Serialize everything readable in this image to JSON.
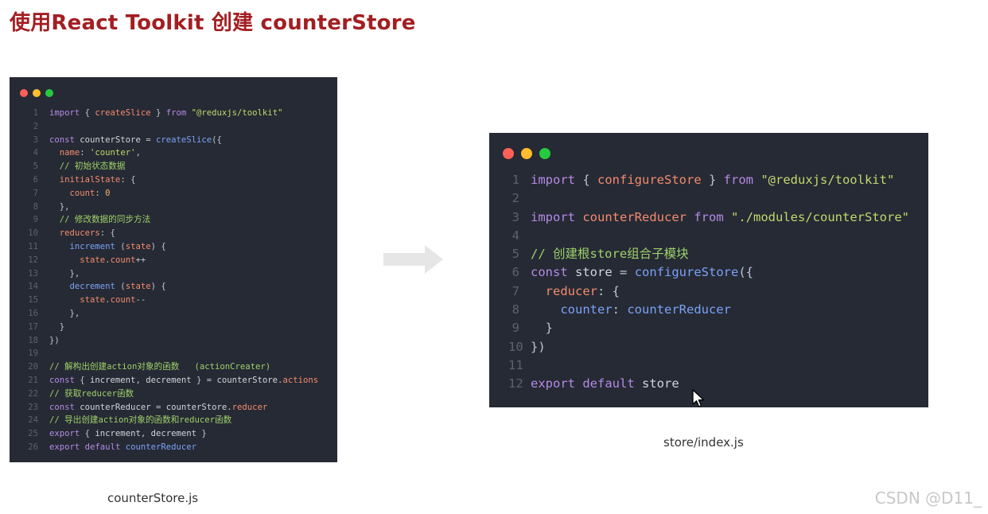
{
  "title": "使用React Toolkit 创建 counterStore",
  "colors": {
    "title": "#a31e22",
    "window_bg": "#262a34",
    "dot_red": "#ff5f56",
    "dot_yellow": "#ffbd2e",
    "dot_green": "#27c93f",
    "line_number": "#5b6270"
  },
  "syntax_colors": {
    "kw": "#b58ae6",
    "fn": "#7aa2f7",
    "str": "#c4d66e",
    "prop": "#f38b6e",
    "cmt": "#9ed16b",
    "punc": "#c0c5ce",
    "num": "#f7b267",
    "def": "#d0d5dd"
  },
  "left_window": {
    "caption": "counterStore.js",
    "lines": [
      {
        "n": "1",
        "tokens": [
          {
            "t": "import",
            "c": "kw"
          },
          {
            "t": " { ",
            "c": "punc"
          },
          {
            "t": "createSlice",
            "c": "prop"
          },
          {
            "t": " } ",
            "c": "punc"
          },
          {
            "t": "from",
            "c": "kw"
          },
          {
            "t": " ",
            "c": "punc"
          },
          {
            "t": "\"@reduxjs/toolkit\"",
            "c": "str"
          }
        ]
      },
      {
        "n": "2",
        "tokens": []
      },
      {
        "n": "3",
        "tokens": [
          {
            "t": "const",
            "c": "kw"
          },
          {
            "t": " ",
            "c": "punc"
          },
          {
            "t": "counterStore",
            "c": "def"
          },
          {
            "t": " = ",
            "c": "punc"
          },
          {
            "t": "createSlice",
            "c": "fn"
          },
          {
            "t": "({",
            "c": "punc"
          }
        ]
      },
      {
        "n": "4",
        "tokens": [
          {
            "t": "  ",
            "c": "punc"
          },
          {
            "t": "name",
            "c": "prop"
          },
          {
            "t": ": ",
            "c": "punc"
          },
          {
            "t": "'counter'",
            "c": "str"
          },
          {
            "t": ",",
            "c": "punc"
          }
        ]
      },
      {
        "n": "5",
        "tokens": [
          {
            "t": "  // 初始状态数据",
            "c": "cmt"
          }
        ]
      },
      {
        "n": "6",
        "tokens": [
          {
            "t": "  ",
            "c": "punc"
          },
          {
            "t": "initialState",
            "c": "prop"
          },
          {
            "t": ": {",
            "c": "punc"
          }
        ]
      },
      {
        "n": "7",
        "tokens": [
          {
            "t": "    ",
            "c": "punc"
          },
          {
            "t": "count",
            "c": "prop"
          },
          {
            "t": ": ",
            "c": "punc"
          },
          {
            "t": "0",
            "c": "num"
          }
        ]
      },
      {
        "n": "8",
        "tokens": [
          {
            "t": "  },",
            "c": "punc"
          }
        ]
      },
      {
        "n": "9",
        "tokens": [
          {
            "t": "  // 修改数据的同步方法",
            "c": "cmt"
          }
        ]
      },
      {
        "n": "10",
        "tokens": [
          {
            "t": "  ",
            "c": "punc"
          },
          {
            "t": "reducers",
            "c": "prop"
          },
          {
            "t": ": {",
            "c": "punc"
          }
        ]
      },
      {
        "n": "11",
        "tokens": [
          {
            "t": "    ",
            "c": "punc"
          },
          {
            "t": "increment",
            "c": "fn"
          },
          {
            "t": " (",
            "c": "punc"
          },
          {
            "t": "state",
            "c": "prop"
          },
          {
            "t": ") {",
            "c": "punc"
          }
        ]
      },
      {
        "n": "12",
        "tokens": [
          {
            "t": "      ",
            "c": "punc"
          },
          {
            "t": "state",
            "c": "prop"
          },
          {
            "t": ".",
            "c": "punc"
          },
          {
            "t": "count",
            "c": "prop"
          },
          {
            "t": "++",
            "c": "punc"
          }
        ]
      },
      {
        "n": "13",
        "tokens": [
          {
            "t": "    },",
            "c": "punc"
          }
        ]
      },
      {
        "n": "14",
        "tokens": [
          {
            "t": "    ",
            "c": "punc"
          },
          {
            "t": "decrement",
            "c": "fn"
          },
          {
            "t": " (",
            "c": "punc"
          },
          {
            "t": "state",
            "c": "prop"
          },
          {
            "t": ") {",
            "c": "punc"
          }
        ]
      },
      {
        "n": "15",
        "tokens": [
          {
            "t": "      ",
            "c": "punc"
          },
          {
            "t": "state",
            "c": "prop"
          },
          {
            "t": ".",
            "c": "punc"
          },
          {
            "t": "count",
            "c": "prop"
          },
          {
            "t": "--",
            "c": "punc"
          }
        ]
      },
      {
        "n": "16",
        "tokens": [
          {
            "t": "    },",
            "c": "punc"
          }
        ]
      },
      {
        "n": "17",
        "tokens": [
          {
            "t": "  }",
            "c": "punc"
          }
        ]
      },
      {
        "n": "18",
        "tokens": [
          {
            "t": "})",
            "c": "punc"
          }
        ]
      },
      {
        "n": "19",
        "tokens": []
      },
      {
        "n": "20",
        "tokens": [
          {
            "t": "// 解构出创建action对象的函数   (actionCreater)",
            "c": "cmt"
          }
        ]
      },
      {
        "n": "21",
        "tokens": [
          {
            "t": "const",
            "c": "kw"
          },
          {
            "t": " { ",
            "c": "punc"
          },
          {
            "t": "increment",
            "c": "def"
          },
          {
            "t": ", ",
            "c": "punc"
          },
          {
            "t": "decrement",
            "c": "def"
          },
          {
            "t": " } = ",
            "c": "punc"
          },
          {
            "t": "counterStore",
            "c": "def"
          },
          {
            "t": ".",
            "c": "punc"
          },
          {
            "t": "actions",
            "c": "prop"
          }
        ]
      },
      {
        "n": "22",
        "tokens": [
          {
            "t": "// 获取reducer函数",
            "c": "cmt"
          }
        ]
      },
      {
        "n": "23",
        "tokens": [
          {
            "t": "const",
            "c": "kw"
          },
          {
            "t": " ",
            "c": "punc"
          },
          {
            "t": "counterReducer",
            "c": "def"
          },
          {
            "t": " = ",
            "c": "punc"
          },
          {
            "t": "counterStore",
            "c": "def"
          },
          {
            "t": ".",
            "c": "punc"
          },
          {
            "t": "reducer",
            "c": "prop"
          }
        ]
      },
      {
        "n": "24",
        "tokens": [
          {
            "t": "// 导出创建action对象的函数和reducer函数",
            "c": "cmt"
          }
        ]
      },
      {
        "n": "25",
        "tokens": [
          {
            "t": "export",
            "c": "kw"
          },
          {
            "t": " { ",
            "c": "punc"
          },
          {
            "t": "increment",
            "c": "def"
          },
          {
            "t": ", ",
            "c": "punc"
          },
          {
            "t": "decrement",
            "c": "def"
          },
          {
            "t": " }",
            "c": "punc"
          }
        ]
      },
      {
        "n": "26",
        "tokens": [
          {
            "t": "export",
            "c": "kw"
          },
          {
            "t": " ",
            "c": "punc"
          },
          {
            "t": "default",
            "c": "kw"
          },
          {
            "t": " ",
            "c": "punc"
          },
          {
            "t": "counterReducer",
            "c": "fn"
          }
        ]
      }
    ]
  },
  "right_window": {
    "caption": "store/index.js",
    "lines": [
      {
        "n": "1",
        "tokens": [
          {
            "t": "import",
            "c": "kw"
          },
          {
            "t": " { ",
            "c": "punc"
          },
          {
            "t": "configureStore",
            "c": "prop"
          },
          {
            "t": " } ",
            "c": "punc"
          },
          {
            "t": "from",
            "c": "kw"
          },
          {
            "t": " ",
            "c": "punc"
          },
          {
            "t": "\"@reduxjs/toolkit\"",
            "c": "str"
          }
        ]
      },
      {
        "n": "2",
        "tokens": []
      },
      {
        "n": "3",
        "tokens": [
          {
            "t": "import",
            "c": "kw"
          },
          {
            "t": " ",
            "c": "punc"
          },
          {
            "t": "counterReducer",
            "c": "prop"
          },
          {
            "t": " ",
            "c": "punc"
          },
          {
            "t": "from",
            "c": "kw"
          },
          {
            "t": " ",
            "c": "punc"
          },
          {
            "t": "\"./modules/counterStore\"",
            "c": "str"
          }
        ]
      },
      {
        "n": "4",
        "tokens": []
      },
      {
        "n": "5",
        "tokens": [
          {
            "t": "// 创建根store组合子模块",
            "c": "cmt"
          }
        ]
      },
      {
        "n": "6",
        "tokens": [
          {
            "t": "const",
            "c": "kw"
          },
          {
            "t": " ",
            "c": "punc"
          },
          {
            "t": "store",
            "c": "def"
          },
          {
            "t": " = ",
            "c": "punc"
          },
          {
            "t": "configureStore",
            "c": "fn"
          },
          {
            "t": "({",
            "c": "punc"
          }
        ]
      },
      {
        "n": "7",
        "tokens": [
          {
            "t": "  ",
            "c": "punc"
          },
          {
            "t": "reducer",
            "c": "prop"
          },
          {
            "t": ": {",
            "c": "punc"
          }
        ]
      },
      {
        "n": "8",
        "tokens": [
          {
            "t": "    ",
            "c": "punc"
          },
          {
            "t": "counter",
            "c": "fn"
          },
          {
            "t": ": ",
            "c": "punc"
          },
          {
            "t": "counterReducer",
            "c": "fn"
          }
        ]
      },
      {
        "n": "9",
        "tokens": [
          {
            "t": "  }",
            "c": "punc"
          }
        ]
      },
      {
        "n": "10",
        "tokens": [
          {
            "t": "})",
            "c": "punc"
          }
        ]
      },
      {
        "n": "11",
        "tokens": []
      },
      {
        "n": "12",
        "tokens": [
          {
            "t": "export",
            "c": "kw"
          },
          {
            "t": " ",
            "c": "punc"
          },
          {
            "t": "default",
            "c": "kw"
          },
          {
            "t": " ",
            "c": "punc"
          },
          {
            "t": "store",
            "c": "def"
          }
        ]
      }
    ]
  },
  "arrow_icon": "right-arrow-icon",
  "cursor_icon": "mouse-cursor-icon",
  "watermark": "CSDN @D11_"
}
